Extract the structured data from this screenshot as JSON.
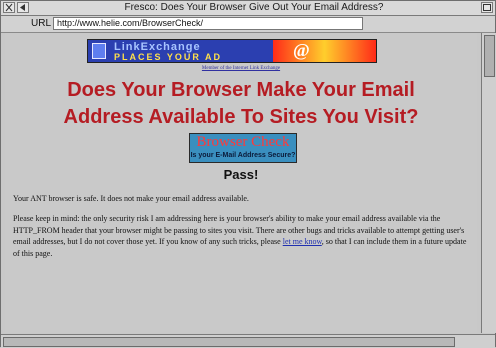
{
  "window": {
    "title": "Fresco: Does Your Browser Give Out Your Email Address?",
    "url_label": "URL",
    "url_value": "http://www.helie.com/BrowserCheck/"
  },
  "banner": {
    "line1": "LinkExchange",
    "line2": "PLACES YOUR AD",
    "at_symbol": "@",
    "member_note_link": "Member of the Internet Link Exchange"
  },
  "page": {
    "headline_line1": "Does Your Browser Make Your Email",
    "headline_line2": "Address Available To Sites You Visit?",
    "badge_title": "Browser Check",
    "badge_subtitle": "Is your E-Mail Address Secure?",
    "result": "Pass!",
    "para1": "Your ANT browser is safe. It does not make your email address available.",
    "para2_before": "Please keep in mind: the only security risk I am addressing here is your browser's ability to make your email address available via the HTTP_FROM header that your browser might be passing to sites you visit. There are other bugs and tricks available to attempt getting user's email addresses, but I do not cover those yet. If you know of any such tricks, please ",
    "para2_link": "let me know",
    "para2_after": ", so that I can include them in a future update of this page."
  },
  "colors": {
    "headline": "#b51c23",
    "link": "#2030b0",
    "page_background": "#c9c9c9"
  }
}
